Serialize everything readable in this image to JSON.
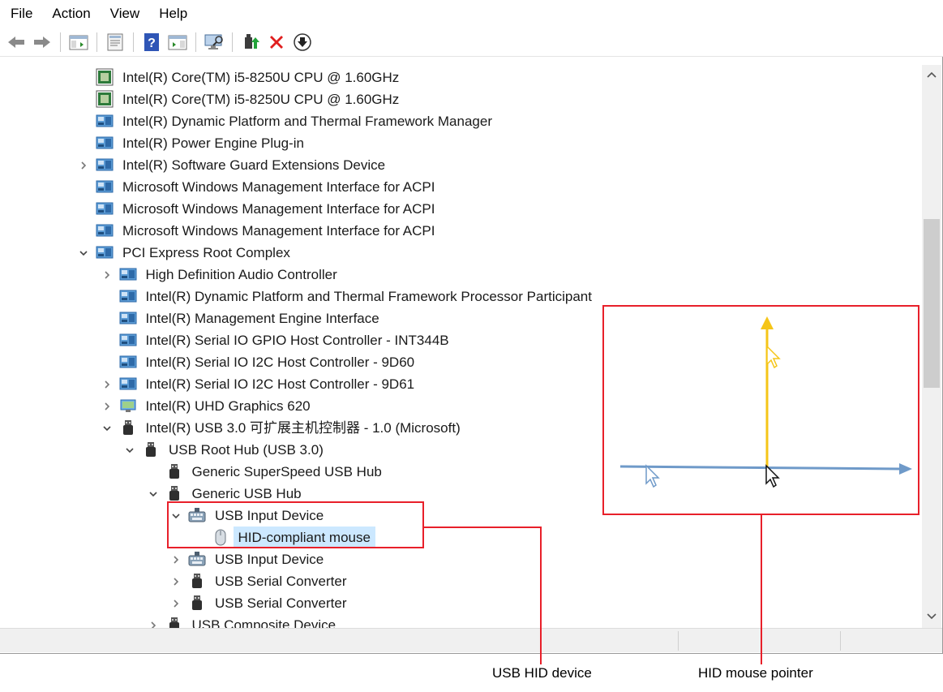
{
  "menu": [
    "File",
    "Action",
    "View",
    "Help"
  ],
  "toolbar": {
    "buttons": [
      "back-icon",
      "forward-icon",
      "show-hide-console-tree-icon",
      "properties-icon",
      "help-icon",
      "action-pane-icon",
      "scan-hardware-icon",
      "update-driver-icon",
      "uninstall-icon",
      "disable-device-icon"
    ]
  },
  "tree": {
    "rows": [
      {
        "label": "Intel(R) Core(TM) i5-8250U CPU @ 1.60GHz",
        "icon": "cpu"
      },
      {
        "label": "Intel(R) Core(TM) i5-8250U CPU @ 1.60GHz",
        "icon": "cpu"
      },
      {
        "label": "Intel(R) Dynamic Platform and Thermal Framework Manager",
        "icon": "system"
      },
      {
        "label": "Intel(R) Power Engine Plug-in",
        "icon": "system"
      },
      {
        "label": "Intel(R) Software Guard Extensions Device",
        "icon": "system",
        "expander": "collapsed"
      },
      {
        "label": "Microsoft Windows Management Interface for ACPI",
        "icon": "system"
      },
      {
        "label": "Microsoft Windows Management Interface for ACPI",
        "icon": "system"
      },
      {
        "label": "Microsoft Windows Management Interface for ACPI",
        "icon": "system"
      },
      {
        "label": "PCI Express Root Complex",
        "icon": "system",
        "expander": "expanded"
      },
      {
        "label": "High Definition Audio Controller",
        "icon": "system",
        "expander": "collapsed"
      },
      {
        "label": "Intel(R) Dynamic Platform and Thermal Framework Processor Participant",
        "icon": "system"
      },
      {
        "label": "Intel(R) Management Engine Interface",
        "icon": "system"
      },
      {
        "label": "Intel(R) Serial IO GPIO Host Controller - INT344B",
        "icon": "system"
      },
      {
        "label": "Intel(R) Serial IO I2C Host Controller - 9D60",
        "icon": "system"
      },
      {
        "label": "Intel(R) Serial IO I2C Host Controller - 9D61",
        "icon": "system",
        "expander": "collapsed"
      },
      {
        "label": "Intel(R) UHD Graphics 620",
        "icon": "display",
        "expander": "collapsed"
      },
      {
        "label": "Intel(R) USB 3.0 可扩展主机控制器 - 1.0 (Microsoft)",
        "icon": "usb",
        "expander": "expanded"
      },
      {
        "label": "USB Root Hub (USB 3.0)",
        "icon": "usb",
        "expander": "expanded"
      },
      {
        "label": "Generic SuperSpeed USB Hub",
        "icon": "usb"
      },
      {
        "label": "Generic USB Hub",
        "icon": "usb",
        "expander": "expanded"
      },
      {
        "label": "USB Input Device",
        "icon": "hid",
        "expander": "expanded"
      },
      {
        "label": "HID-compliant mouse",
        "icon": "mouse",
        "selected": true
      },
      {
        "label": "USB Input Device",
        "icon": "hid",
        "expander": "collapsed"
      },
      {
        "label": "USB Serial Converter",
        "icon": "usb",
        "expander": "collapsed"
      },
      {
        "label": "USB Serial Converter",
        "icon": "usb",
        "expander": "collapsed"
      },
      {
        "label": "USB Composite Device",
        "icon": "usb",
        "expander": "collapsed"
      }
    ]
  },
  "annotations": {
    "usb_hid_caption": "USB HID device",
    "mouse_pointer_caption": "HID mouse pointer"
  },
  "colors": {
    "annotation_red": "#e8202a",
    "x_axis_blue": "#6f9ac9",
    "y_axis_yellow": "#f5c518",
    "selection": "#cce8ff"
  }
}
